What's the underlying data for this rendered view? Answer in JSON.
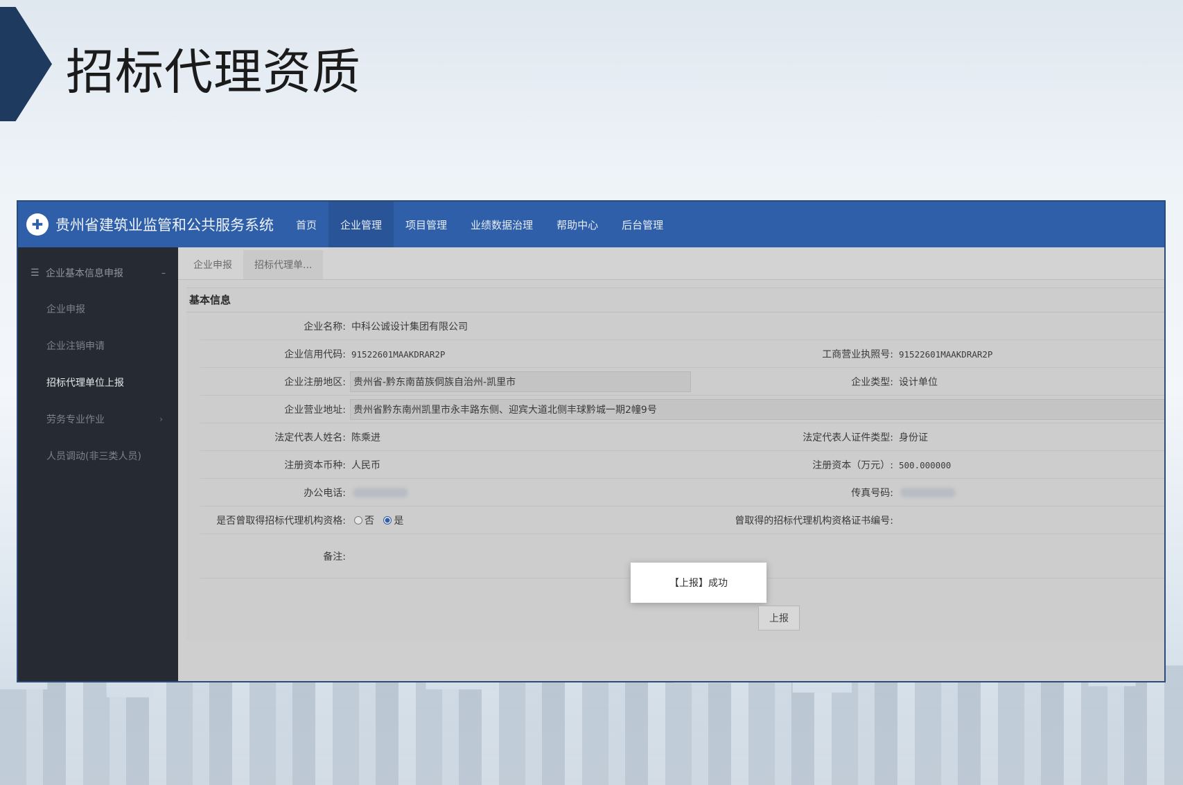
{
  "slide": {
    "title": "招标代理资质"
  },
  "header": {
    "system_name": "贵州省建筑业监管和公共服务系统",
    "nav": [
      {
        "label": "首页"
      },
      {
        "label": "企业管理"
      },
      {
        "label": "项目管理"
      },
      {
        "label": "业绩数据治理"
      },
      {
        "label": "帮助中心"
      },
      {
        "label": "后台管理"
      }
    ]
  },
  "sidebar": {
    "group_label": "企业基本信息申报",
    "items": [
      {
        "label": "企业申报"
      },
      {
        "label": "企业注销申请"
      },
      {
        "label": "招标代理单位上报"
      },
      {
        "label": "劳务专业作业"
      },
      {
        "label": "人员调动(非三类人员)"
      }
    ]
  },
  "tabs": [
    {
      "label": "企业申报"
    },
    {
      "label": "招标代理单..."
    }
  ],
  "form": {
    "section_title": "基本信息",
    "company_name_label": "企业名称:",
    "company_name": "中科公诚设计集团有限公司",
    "credit_code_label": "企业信用代码:",
    "credit_code": "91522601MAAKDRAR2P",
    "license_no_label": "工商营业执照号:",
    "license_no": "91522601MAAKDRAR2P",
    "reg_region_label": "企业注册地区:",
    "reg_region": "贵州省-黔东南苗族侗族自治州-凯里市",
    "company_type_label": "企业类型:",
    "company_type": "设计单位",
    "address_label": "企业营业地址:",
    "address": "贵州省黔东南州凯里市永丰路东侧、迎宾大道北侧丰球黔城一期2幢9号",
    "legal_rep_label": "法定代表人姓名:",
    "legal_rep": "陈乘进",
    "id_type_label": "法定代表人证件类型:",
    "id_type": "身份证",
    "currency_label": "注册资本币种:",
    "currency": "人民币",
    "capital_label": "注册资本（万元）:",
    "capital": "500.000000",
    "phone_label": "办公电话:",
    "fax_label": "传真号码:",
    "qualified_label": "是否曾取得招标代理机构资格:",
    "option_no": "否",
    "option_yes": "是",
    "cert_no_label": "曾取得的招标代理机构资格证书编号:",
    "remark_label": "备注:"
  },
  "toast": {
    "message": "【上报】成功"
  },
  "actions": {
    "submit_label": "上报"
  }
}
